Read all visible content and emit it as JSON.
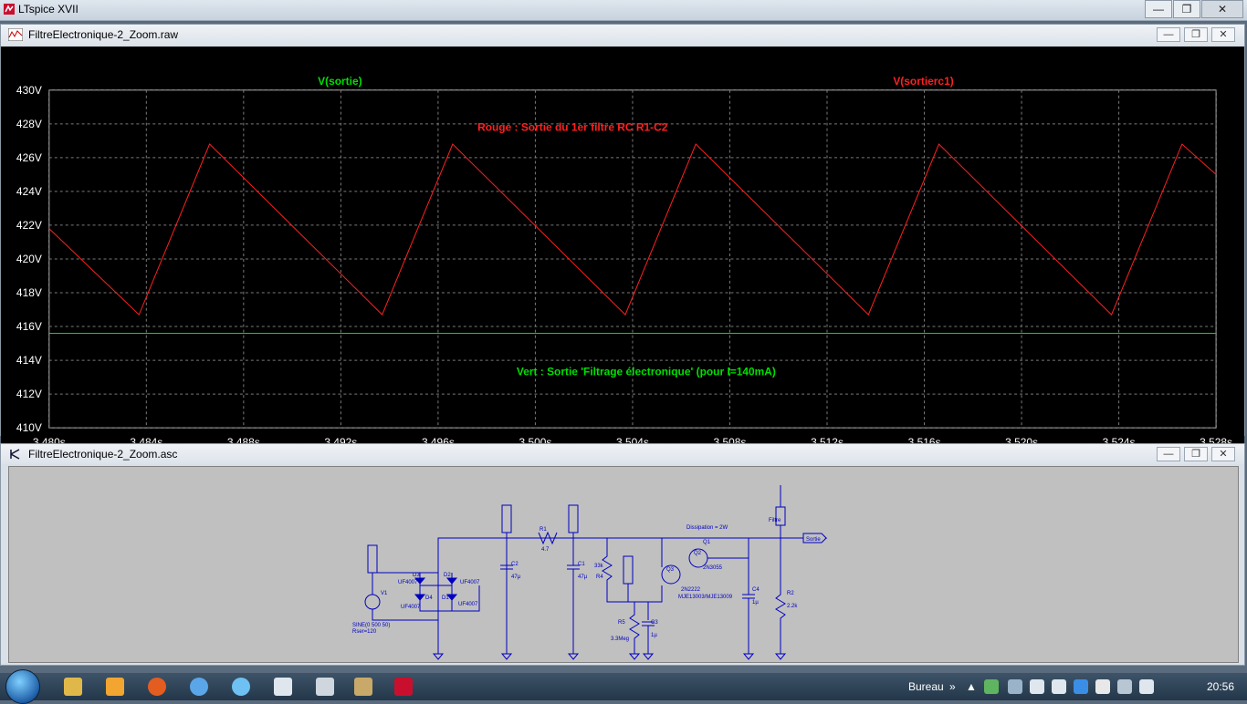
{
  "app": {
    "title": "LTspice XVII"
  },
  "plot_window": {
    "title": "FiltreElectronique-2_Zoom.raw",
    "traces": [
      "V(sortie)",
      "V(sortierc1)"
    ],
    "annotations": {
      "red": "Rouge : Sortie du 1er filtre RC   R1-C2",
      "green": "Vert : Sortie 'Filtrage électronique' (pour I=140mA)"
    },
    "colors": {
      "red": "#ff2020",
      "green": "#00e000",
      "grid": "#7a7a7a",
      "bg": "#000000"
    },
    "y_ticks": [
      "430V",
      "428V",
      "426V",
      "424V",
      "422V",
      "420V",
      "418V",
      "416V",
      "414V",
      "412V",
      "410V"
    ],
    "x_ticks": [
      "3.480s",
      "3.484s",
      "3.488s",
      "3.492s",
      "3.496s",
      "3.500s",
      "3.504s",
      "3.508s",
      "3.512s",
      "3.516s",
      "3.520s",
      "3.524s",
      "3.528s"
    ]
  },
  "chart_data": {
    "type": "line",
    "xlabel": "",
    "ylabel": "",
    "xlim": [
      3.48,
      3.528
    ],
    "ylim": [
      410,
      430
    ],
    "grid": true,
    "series": [
      {
        "name": "V(sortie)",
        "x": [
          3.48,
          3.528
        ],
        "values": [
          415.6,
          415.6
        ]
      },
      {
        "name": "V(sortierc1)",
        "x": [
          3.48,
          3.4837,
          3.4866,
          3.4937,
          3.4966,
          3.5037,
          3.5066,
          3.5137,
          3.5166,
          3.5237,
          3.5266,
          3.528
        ],
        "values": [
          421.8,
          416.7,
          426.8,
          416.7,
          426.8,
          416.7,
          426.8,
          416.7,
          426.8,
          416.7,
          426.8,
          425.0
        ]
      }
    ]
  },
  "schematic_window": {
    "title": "FiltreElectronique-2_Zoom.asc",
    "labels": {
      "source": "SINE(0 500 50)",
      "rser": "Rser=120",
      "v1": "V1",
      "d1": "D1",
      "d2": "D2",
      "d3": "D3",
      "d4": "D4",
      "d_type": "UF4007",
      "r1": "R1",
      "r1_val": "4.7",
      "c2": "C2",
      "c2_val": "47µ",
      "c1": "C1",
      "c1_val": "47µ",
      "r4": "R4",
      "r4_val": "33k",
      "r5": "R5",
      "r5_val": "3.3Meg",
      "c3": "C3",
      "c3_val": "1µ",
      "q1": "Q1",
      "q2": "Q2",
      "q3": "Q3",
      "q3_type": "2N2222",
      "q2_type": "2N3055",
      "mje": "MJE13003/MJE13009",
      "c4": "C4",
      "c4_val": "1µ",
      "r2": "R2",
      "r2_val": "2.2k",
      "out": "Sortie",
      "filtre": "Filtre",
      "diss": "Dissipation = 2W"
    }
  },
  "taskbar": {
    "tray_label": "Bureau",
    "clock": "20:56"
  }
}
